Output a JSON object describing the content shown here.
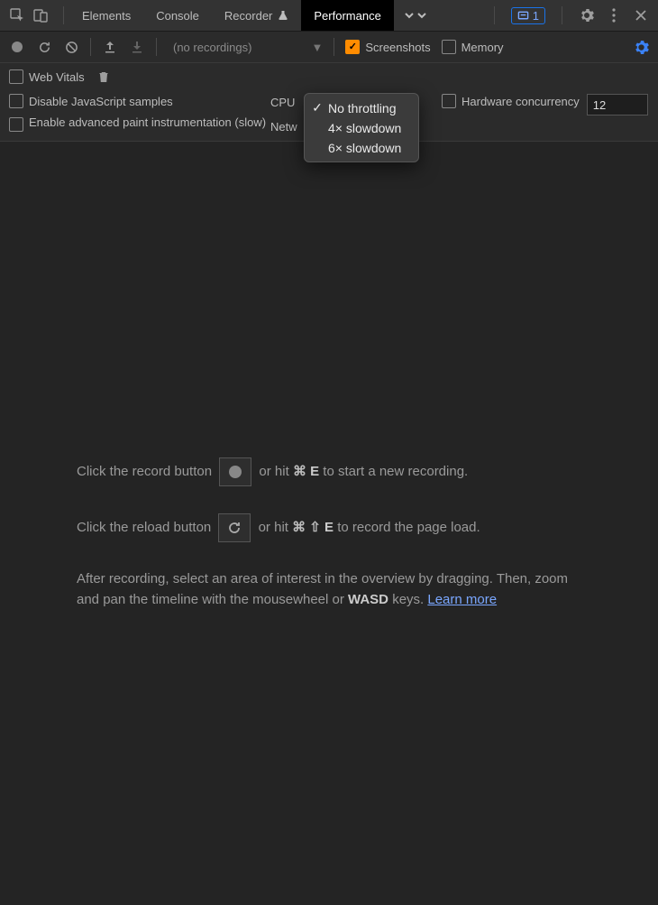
{
  "tabs": {
    "elements": "Elements",
    "console": "Console",
    "recorder": "Recorder",
    "performance": "Performance"
  },
  "badge_count": "1",
  "toolbar": {
    "recordings_placeholder": "(no recordings)",
    "screenshots": "Screenshots",
    "memory": "Memory"
  },
  "options": {
    "web_vitals": "Web Vitals",
    "disable_js": "Disable JavaScript samples",
    "advanced_paint": "Enable advanced paint instrumentation (slow)",
    "cpu_label": "CPU",
    "network_label": "Netw",
    "hardware_concurrency": "Hardware concurrency",
    "hw_value": "12"
  },
  "cpu_dropdown": {
    "no_throttling": "No throttling",
    "slow4x": "4× slowdown",
    "slow6x": "6× slowdown"
  },
  "help": {
    "p1a": "Click the record button ",
    "p1b": " or hit ",
    "p1_cmd": "⌘",
    "p1_key": "E",
    "p1c": " to start a new recording.",
    "p2a": "Click the reload button ",
    "p2b": " or hit ",
    "p2_cmd": "⌘",
    "p2_shift": "⇧",
    "p2_key": "E",
    "p2c": " to record the page load.",
    "p3a": "After recording, select an area of interest in the overview by dragging. Then, zoom and pan the timeline with the mousewheel or ",
    "p3_wasd": "WASD",
    "p3b": " keys. ",
    "learn": "Learn more"
  }
}
